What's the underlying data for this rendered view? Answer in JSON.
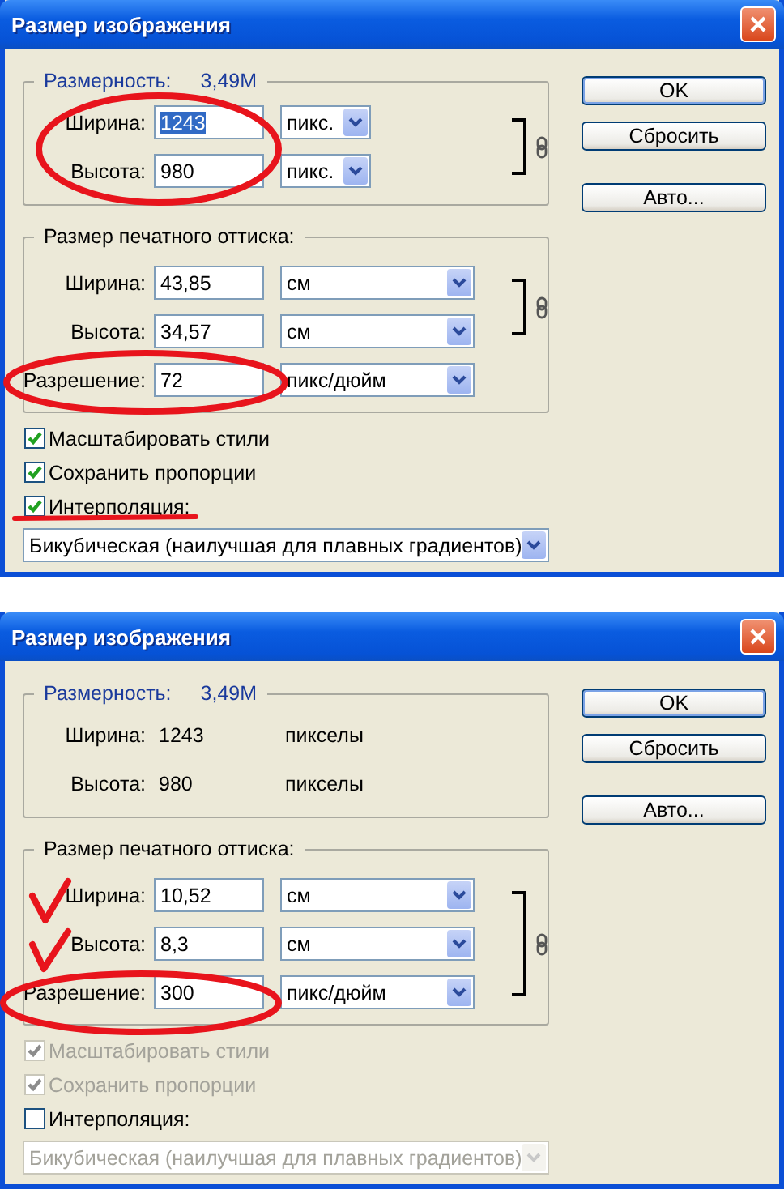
{
  "dialogs": [
    {
      "title": "Размер изображения",
      "pixel_dimensions": {
        "label": "Размерность:",
        "value": "3,49M",
        "rows": [
          {
            "kind": "field",
            "label": "Ширина:",
            "value": "1243",
            "selected": true,
            "unit": "пикс.",
            "linked": true
          },
          {
            "kind": "field",
            "label": "Высота:",
            "value": "980",
            "selected": false,
            "unit": "пикс.",
            "linked": true
          }
        ]
      },
      "print_size": {
        "label": "Размер печатного оттиска:",
        "rows": [
          {
            "kind": "field",
            "label": "Ширина:",
            "value": "43,85",
            "selected": false,
            "unit": "см",
            "linked": true
          },
          {
            "kind": "field",
            "label": "Высота:",
            "value": "34,57",
            "selected": false,
            "unit": "см",
            "linked": true
          },
          {
            "kind": "field",
            "label": "Разрешение:",
            "value": "72",
            "selected": false,
            "unit": "пикс/дюйм",
            "linked": false
          }
        ]
      },
      "options": [
        {
          "label": "Масштабировать стили",
          "checked": true,
          "disabled": false
        },
        {
          "label": "Сохранить пропорции",
          "checked": true,
          "disabled": false
        },
        {
          "label": "Интерполяция:",
          "checked": true,
          "disabled": false
        }
      ],
      "interpolation": {
        "value": "Бикубическая (наилучшая для плавных градиентов)",
        "disabled": false
      },
      "buttons": [
        "OK",
        "Сбросить",
        "Авто..."
      ]
    },
    {
      "title": "Размер изображения",
      "pixel_dimensions": {
        "label": "Размерность:",
        "value": "3,49M",
        "rows": [
          {
            "kind": "static",
            "label": "Ширина:",
            "value": "1243",
            "unit": "пикселы"
          },
          {
            "kind": "static",
            "label": "Высота:",
            "value": "980",
            "unit": "пикселы"
          }
        ]
      },
      "print_size": {
        "label": "Размер печатного оттиска:",
        "rows": [
          {
            "kind": "field",
            "label": "Ширина:",
            "value": "10,52",
            "selected": false,
            "unit": "см",
            "linked": true
          },
          {
            "kind": "field",
            "label": "Высота:",
            "value": "8,3",
            "selected": false,
            "unit": "см",
            "linked": true
          },
          {
            "kind": "field",
            "label": "Разрешение:",
            "value": "300",
            "selected": false,
            "unit": "пикс/дюйм",
            "linked": true
          }
        ]
      },
      "options": [
        {
          "label": "Масштабировать стили",
          "checked": true,
          "disabled": true
        },
        {
          "label": "Сохранить пропорции",
          "checked": true,
          "disabled": true
        },
        {
          "label": "Интерполяция:",
          "checked": false,
          "disabled": false
        }
      ],
      "interpolation": {
        "value": "Бикубическая (наилучшая для плавных градиентов)",
        "disabled": true
      },
      "buttons": [
        "OK",
        "Сбросить",
        "Авто..."
      ]
    }
  ]
}
